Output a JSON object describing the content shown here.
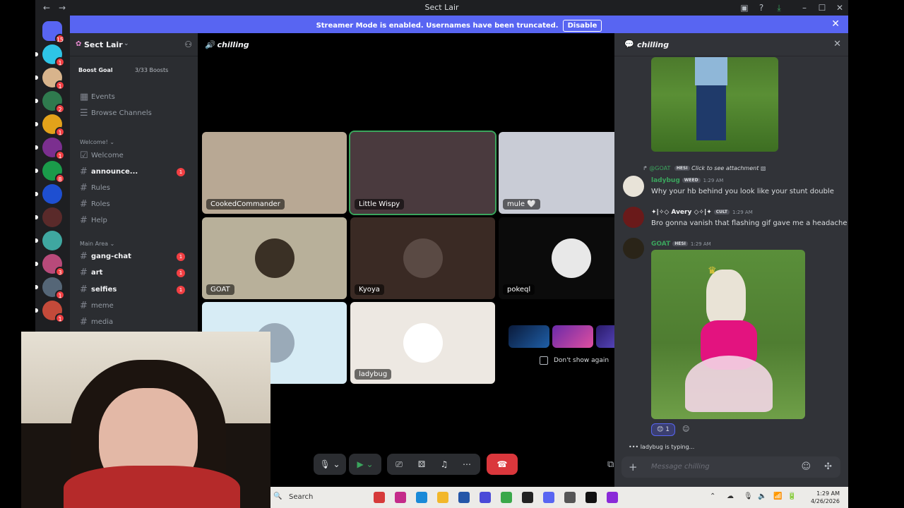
{
  "window": {
    "title": "Sect Lair"
  },
  "banner": {
    "message": "Streamer Mode is enabled. Usernames have been truncated.",
    "disable_label": "Disable"
  },
  "rail": {
    "servers": [
      {
        "badge": "15",
        "color": "#5865f2"
      },
      {
        "badge": "1",
        "color": "#2ec4e6"
      },
      {
        "badge": "1",
        "color": "#d8b48c"
      },
      {
        "badge": "2",
        "color": "#2f7a4e"
      },
      {
        "badge": "1",
        "color": "#e3a21a"
      },
      {
        "badge": "1",
        "color": "#7b2f8f"
      },
      {
        "badge": "8",
        "color": "#1a9b4a"
      },
      {
        "badge": "",
        "color": "#1e4fd1"
      },
      {
        "badge": "",
        "color": "#5a2a2a"
      },
      {
        "badge": "",
        "color": "#3fa7a0"
      },
      {
        "badge": "3",
        "color": "#b84a7a"
      },
      {
        "badge": "1",
        "color": "#556677"
      },
      {
        "badge": "1",
        "color": "#c44a3a"
      }
    ]
  },
  "sidebar": {
    "guild_name": "Sect Lair",
    "boost_goal": "Boost Goal",
    "boost_count": "3/33 Boosts",
    "events": "Events",
    "browse": "Browse Channels",
    "cat_welcome": "Welcome!",
    "cat_main": "Main Area",
    "channels": [
      {
        "label": "Welcome",
        "unread": false,
        "badge": ""
      },
      {
        "label": "announce...",
        "unread": true,
        "badge": "1"
      },
      {
        "label": "Rules",
        "unread": false,
        "badge": ""
      },
      {
        "label": "Roles",
        "unread": false,
        "badge": ""
      },
      {
        "label": "Help",
        "unread": false,
        "badge": ""
      },
      {
        "label": "gang-chat",
        "unread": true,
        "badge": "1"
      },
      {
        "label": "art",
        "unread": true,
        "badge": "1"
      },
      {
        "label": "selfies",
        "unread": true,
        "badge": "1"
      },
      {
        "label": "meme",
        "unread": false,
        "badge": ""
      },
      {
        "label": "media",
        "unread": false,
        "badge": ""
      }
    ]
  },
  "voice": {
    "channel": "chilling",
    "tiles": [
      {
        "name": "CookedCommander",
        "bg": "#b8a894"
      },
      {
        "name": "Little Wispy",
        "bg": "#4a3a3e",
        "active": true
      },
      {
        "name": "mule 🤍",
        "bg": "#c9ccd6"
      },
      {
        "name": "GOAT",
        "bg": "#b8b09a"
      },
      {
        "name": "Kyoya",
        "bg": "#3a2a24"
      },
      {
        "name": "pokeql",
        "bg": "#0b0b0b"
      },
      {
        "name": "",
        "bg": "#d7ecf5"
      },
      {
        "name": "ladybug",
        "bg": "#ede8e2"
      }
    ],
    "promo_dont_show": "Don't show again"
  },
  "chat": {
    "channel": "chilling",
    "messages": [
      {
        "reply_to": "@GOAT",
        "reply_tag": "HESI",
        "reply_text": "Click to see attachment",
        "author": "ladybug",
        "tag": "WEED",
        "time": "1:29 AM",
        "text": "Why your hb behind you look like your stunt double",
        "color": "#3ba55d"
      },
      {
        "author": "✦|✧◇ Avery ◇✧|✦",
        "tag": "CULT",
        "time": "1:29 AM",
        "text": "Bro gonna vanish that flashing gif gave me a headache",
        "color": "#f2f3f5"
      },
      {
        "author": "GOAT",
        "tag": "HESI",
        "time": "1:29 AM",
        "text": "",
        "color": "#3ba55d"
      }
    ],
    "reaction_count": "1",
    "typing": "ladybug is typing...",
    "placeholder": "Message chilling"
  },
  "taskbar": {
    "search": "Search",
    "time": "1:29 AM",
    "date": "4/26/2026"
  }
}
